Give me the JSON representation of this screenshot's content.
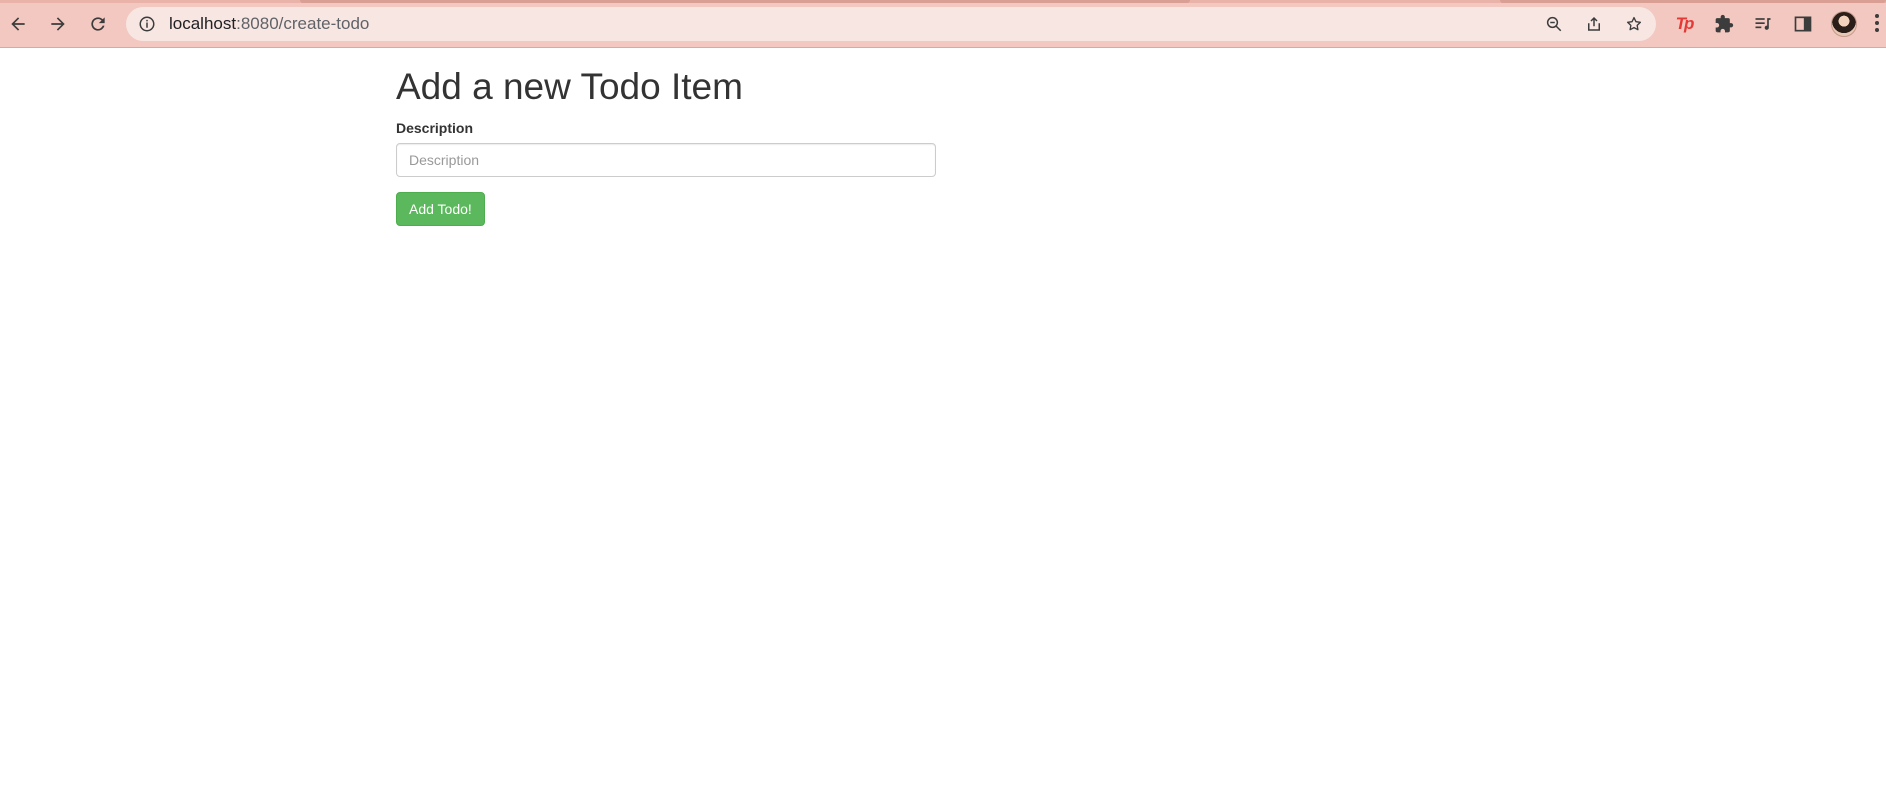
{
  "browser": {
    "url_host": "localhost",
    "url_path": ":8080/create-todo",
    "toolbar_color": "#f2c8c0",
    "omnibox_color": "#f8e6e3",
    "nav_icons": [
      "back-arrow-icon",
      "forward-arrow-icon",
      "reload-icon"
    ],
    "omnibox_icons": [
      "site-info-icon",
      "zoom-out-icon",
      "share-icon",
      "bookmark-star-icon"
    ],
    "extension_icons": [
      "tp-extension-icon",
      "extensions-puzzle-icon",
      "reading-list-icon",
      "side-panel-icon",
      "profile-avatar",
      "more-menu-icon"
    ],
    "tp_extension_text": "Tp",
    "tp_extension_color": "#e53935"
  },
  "form": {
    "title": "Add a new Todo Item",
    "description_label": "Description",
    "description_placeholder": "Description",
    "description_value": "",
    "submit_label": "Add Todo!",
    "submit_color": "#5cb85c"
  }
}
